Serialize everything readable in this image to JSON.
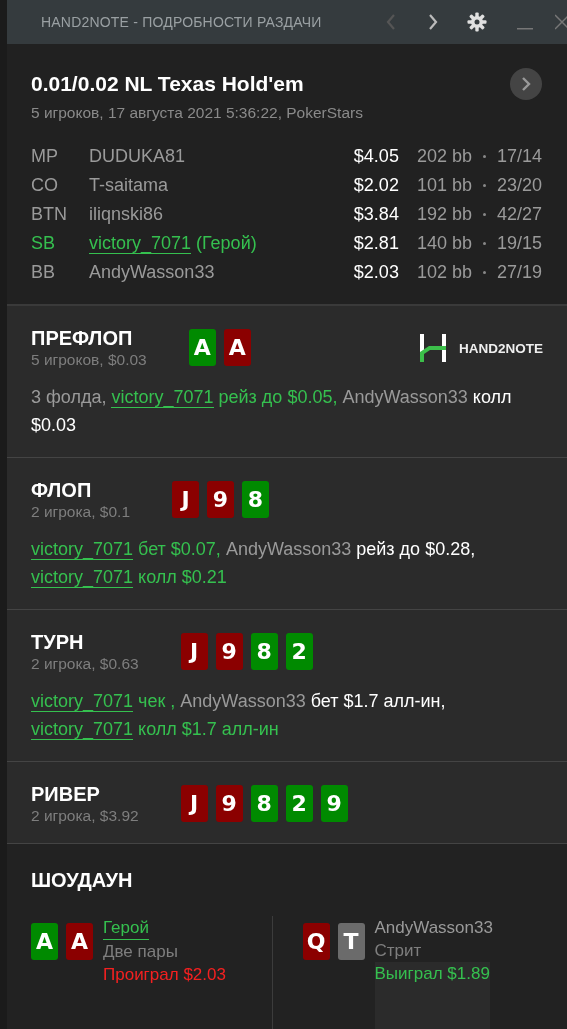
{
  "window": {
    "title": "HAND2NOTE - ПОДРОБНОСТИ РАЗДАЧИ",
    "back_disabled": true
  },
  "hand": {
    "title": "0.01/0.02 NL Texas Hold'em",
    "subtitle": "5 игроков, 17 августа 2021 5:36:22, PokerStars"
  },
  "players": [
    {
      "position": "MP",
      "name": "DUDUKA81",
      "hero": false,
      "stack": "$4.05",
      "bb": "202 bb",
      "stats": "17/14"
    },
    {
      "position": "CO",
      "name": "T-saitama",
      "hero": false,
      "stack": "$2.02",
      "bb": "101 bb",
      "stats": "23/20"
    },
    {
      "position": "BTN",
      "name": "iliqnski86",
      "hero": false,
      "stack": "$3.84",
      "bb": "192 bb",
      "stats": "42/27"
    },
    {
      "position": "SB",
      "name": "victory_7071",
      "hero": true,
      "note": "(Герой)",
      "stack": "$2.81",
      "bb": "140 bb",
      "stats": "19/15"
    },
    {
      "position": "BB",
      "name": "AndyWasson33",
      "hero": false,
      "stack": "$2.03",
      "bb": "102 bb",
      "stats": "27/19"
    }
  ],
  "logo": {
    "text": "HAND2NOTE"
  },
  "streets": [
    {
      "title": "ПРЕФЛОП",
      "info": "5 игроков, $0.03",
      "logo": true,
      "cards": [
        {
          "rank": "A",
          "color": "#008a00"
        },
        {
          "rank": "A",
          "color": "#8b0000"
        }
      ],
      "actions": [
        {
          "kind": "muted",
          "text": "3 фолда, "
        },
        {
          "kind": "hero_name",
          "text": "victory_7071"
        },
        {
          "kind": "hero_text",
          "text": " рейз до $0.05, "
        },
        {
          "kind": "name",
          "text": "AndyWasson33"
        },
        {
          "kind": "text",
          "text": " колл $0.03"
        }
      ]
    },
    {
      "title": "ФЛОП",
      "info": "2 игрока, $0.1",
      "logo": false,
      "cards": [
        {
          "rank": "J",
          "color": "#8b0000"
        },
        {
          "rank": "9",
          "color": "#8b0000"
        },
        {
          "rank": "8",
          "color": "#008a00"
        }
      ],
      "actions": [
        {
          "kind": "hero_name",
          "text": "victory_7071"
        },
        {
          "kind": "hero_text",
          "text": " бет $0.07, "
        },
        {
          "kind": "name",
          "text": "AndyWasson33"
        },
        {
          "kind": "text",
          "text": " рейз до $0.28, "
        },
        {
          "kind": "hero_name",
          "text": "victory_7071"
        },
        {
          "kind": "hero_text",
          "text": " колл $0.21"
        }
      ]
    },
    {
      "title": "ТУРН",
      "info": "2 игрока, $0.63",
      "logo": false,
      "cards": [
        {
          "rank": "J",
          "color": "#8b0000"
        },
        {
          "rank": "9",
          "color": "#8b0000"
        },
        {
          "rank": "8",
          "color": "#008a00"
        },
        {
          "rank": "2",
          "color": "#008a00"
        }
      ],
      "actions": [
        {
          "kind": "hero_name",
          "text": "victory_7071"
        },
        {
          "kind": "hero_text",
          "text": " чек , "
        },
        {
          "kind": "name",
          "text": "AndyWasson33"
        },
        {
          "kind": "text",
          "text": " бет $1.7 алл-ин, "
        },
        {
          "kind": "hero_name",
          "text": "victory_7071"
        },
        {
          "kind": "hero_text",
          "text": " колл $1.7 алл-ин"
        }
      ]
    },
    {
      "title": "РИВЕР",
      "info": "2 игрока, $3.92",
      "logo": false,
      "cards": [
        {
          "rank": "J",
          "color": "#8b0000"
        },
        {
          "rank": "9",
          "color": "#8b0000"
        },
        {
          "rank": "8",
          "color": "#008a00"
        },
        {
          "rank": "2",
          "color": "#008a00"
        },
        {
          "rank": "9",
          "color": "#008a00"
        }
      ]
    }
  ],
  "showdown": {
    "title": "ШОУДАУН",
    "players": [
      {
        "name": "Герой",
        "hero": true,
        "hand": "Две пары",
        "result": "Проиграл $2.03",
        "won": false,
        "cards": [
          {
            "rank": "A",
            "color": "#008a00"
          },
          {
            "rank": "A",
            "color": "#8b0000"
          }
        ]
      },
      {
        "name": "AndyWasson33",
        "hero": false,
        "hand": "Стрит",
        "result": "Выиграл $1.89",
        "won": true,
        "cards": [
          {
            "rank": "Q",
            "color": "#8b0000"
          },
          {
            "rank": "T",
            "color": "#6b6b6b"
          }
        ]
      }
    ]
  }
}
